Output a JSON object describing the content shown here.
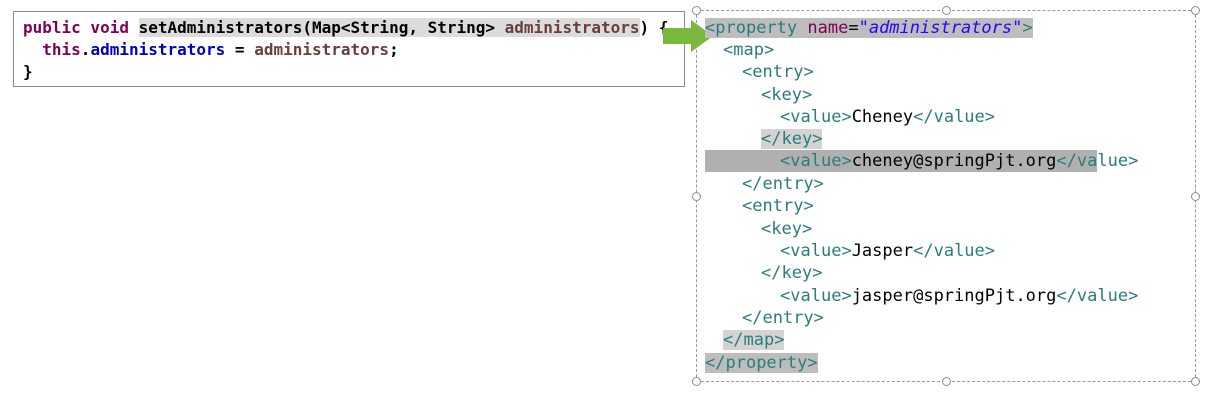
{
  "java": {
    "line1": {
      "modifiers": "public void ",
      "method_name": "setAdministrators",
      "open_paren": "(",
      "param_type": "Map<String, String> ",
      "param_name": "administrators",
      "close": ") {"
    },
    "line2": {
      "indent": "  ",
      "this_kw": "this",
      "dot": ".",
      "field": "administrators",
      "assign": " = ",
      "value": "administrators",
      "semicolon": ";"
    },
    "line3": "}"
  },
  "xml": {
    "open": "<",
    "close": ">",
    "close_open": "</",
    "property_tag": "property",
    "attr_name": "name",
    "attr_eq": "=",
    "attr_value": "\"administrators\"",
    "map_tag": "map",
    "entry_tag": "entry",
    "key_tag": "key",
    "value_tag": "value",
    "entries": [
      {
        "key": "Cheney",
        "value": "cheney@springPjt.org"
      },
      {
        "key": "Jasper",
        "value": "jasper@springPjt.org"
      }
    ]
  },
  "colors": {
    "keyword": "#7f0055",
    "field": "#0000c0",
    "parameter": "#6a3e3e",
    "xml_tag": "#2b7c7c",
    "xml_attr_value": "#2a00ff",
    "arrow": "#78b83a",
    "highlight": "#bdbdbd"
  },
  "icons": {
    "arrow": "right-arrow-icon"
  }
}
